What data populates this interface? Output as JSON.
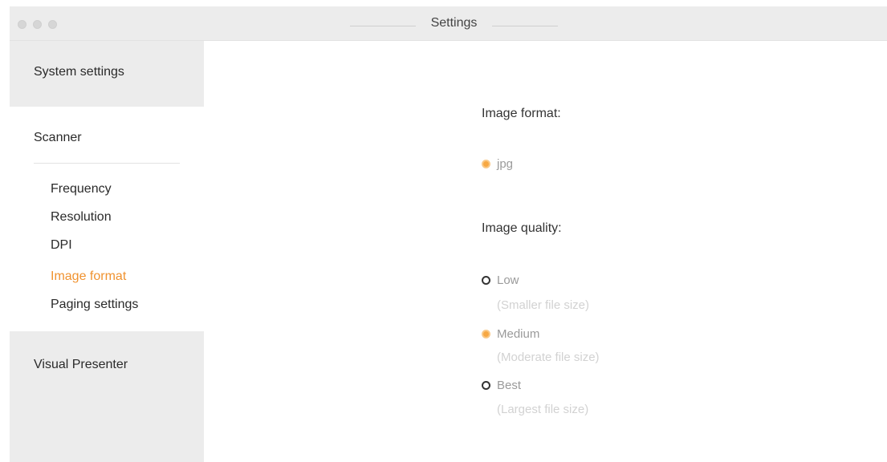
{
  "window": {
    "title": "Settings"
  },
  "sidebar": {
    "system_settings": "System settings",
    "scanner": "Scanner",
    "scanner_items": [
      {
        "label": "Frequency",
        "active": false
      },
      {
        "label": "Resolution",
        "active": false
      },
      {
        "label": "DPI",
        "active": false
      },
      {
        "label": "Image format",
        "active": true
      },
      {
        "label": "Paging settings",
        "active": false
      }
    ],
    "visual_presenter": "Visual Presenter"
  },
  "main": {
    "image_format_heading": "Image format:",
    "format_options": [
      {
        "label": "jpg",
        "selected": true
      }
    ],
    "image_quality_heading": "Image quality:",
    "quality_options": [
      {
        "label": "Low",
        "hint": "(Smaller file size)",
        "selected": false
      },
      {
        "label": "Medium",
        "hint": "(Moderate file size)",
        "selected": true
      },
      {
        "label": "Best",
        "hint": "(Largest file size)",
        "selected": false
      }
    ]
  },
  "colors": {
    "accent": "#f0922f",
    "radio_selected": "#f7a843",
    "sidebar_bg": "#ececec",
    "titlebar_bg": "#ececec"
  }
}
